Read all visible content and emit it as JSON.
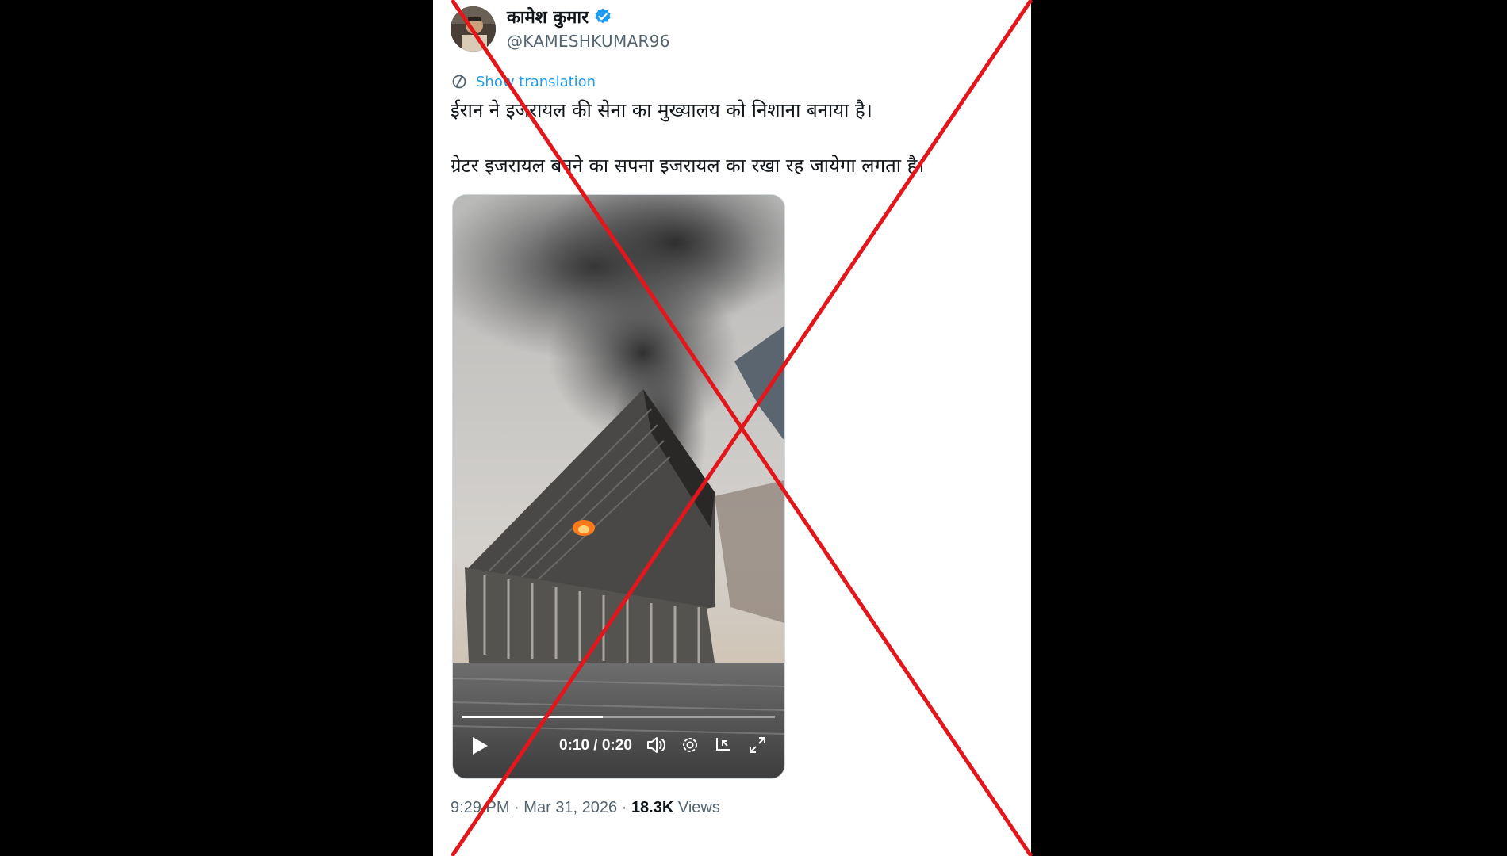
{
  "tweet": {
    "display_name": "कामेश कुमार",
    "handle": "@KAMESHKUMAR96",
    "verified": true,
    "show_translation": "Show translation",
    "text_line1": "ईरान ने इजरायल की सेना का मुख्यालय को निशाना बनाया है।",
    "text_line2": "ग्रेटर इजरायल बनने का सपना इजरायल का रखा रह जायेगा लगता है।",
    "time": "9:29 PM",
    "date": "Mar 31, 2026",
    "views_count": "18.3K",
    "views_label": "Views",
    "separator": "·"
  },
  "video": {
    "time_display": "0:10 / 0:20",
    "progress": 0.45
  },
  "colors": {
    "accent": "#1d9bf0",
    "cross": "#e3161b",
    "text": "#0f1419",
    "muted": "#536471"
  },
  "icons": [
    "verified-badge-icon",
    "translate-icon",
    "play-icon",
    "volume-icon",
    "settings-icon",
    "pip-icon",
    "fullscreen-icon"
  ]
}
